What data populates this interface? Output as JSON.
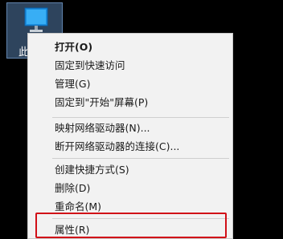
{
  "desktop": {
    "icon_label": "此",
    "icon_name": "computer-icon"
  },
  "context_menu": {
    "items": [
      {
        "label": "打开(O)",
        "bold": true
      },
      {
        "label": "固定到快速访问"
      },
      {
        "label": "管理(G)"
      },
      {
        "label": "固定到\"开始\"屏幕(P)"
      },
      {
        "label": "映射网络驱动器(N)..."
      },
      {
        "label": "断开网络驱动器的连接(C)..."
      },
      {
        "label": "创建快捷方式(S)"
      },
      {
        "label": "删除(D)"
      },
      {
        "label": "重命名(M)"
      },
      {
        "label": "属性(R)"
      }
    ]
  },
  "colors": {
    "highlight_border": "#d10f17",
    "menu_background": "#f2f2f2",
    "icon_selection": "#537baa"
  }
}
